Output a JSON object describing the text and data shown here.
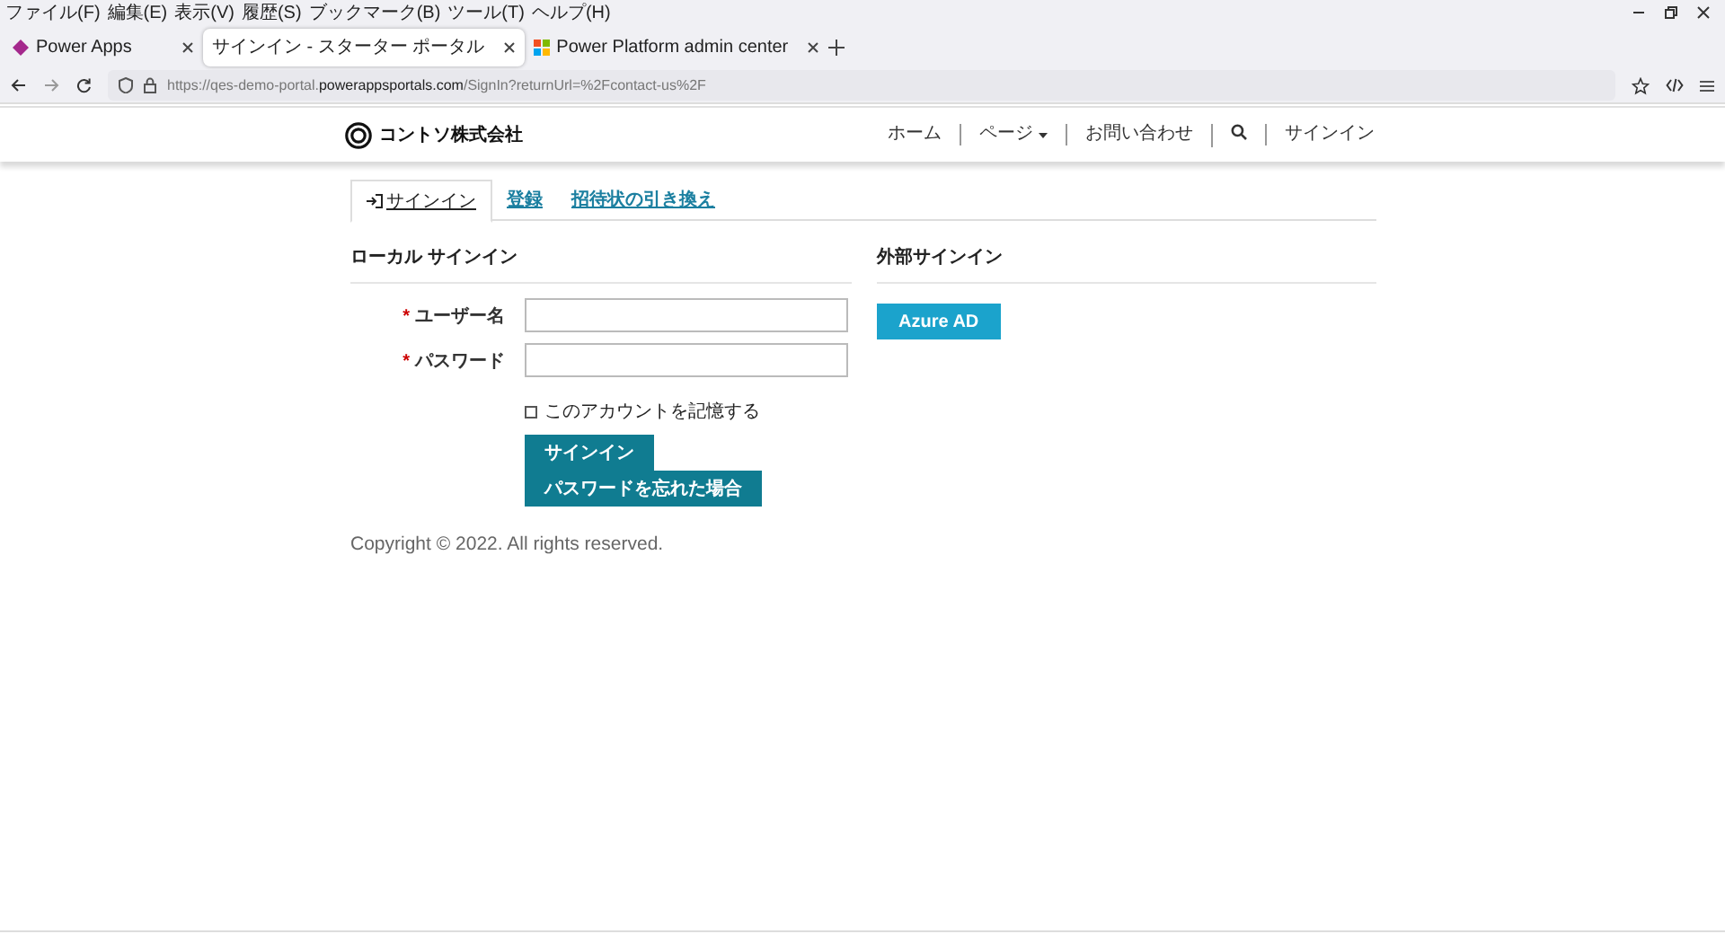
{
  "menu_bar": [
    "ファイル(F)",
    "編集(E)",
    "表示(V)",
    "履歴(S)",
    "ブックマーク(B)",
    "ツール(T)",
    "ヘルプ(H)"
  ],
  "tabs": [
    {
      "title": "Power Apps",
      "kind": "powerapps",
      "selected": false
    },
    {
      "title": "サインイン - スターター ポータル",
      "kind": "blank",
      "selected": true
    },
    {
      "title": "Power Platform admin center",
      "kind": "windows",
      "selected": false
    }
  ],
  "address_bar": {
    "prefix": "https://qes-demo-portal.",
    "domain": "powerappsportals.com",
    "path": "/SignIn?returnUrl=%2Fcontact-us%2F"
  },
  "site_header": {
    "brand": "コントソ株式会社",
    "nav": [
      {
        "label": "ホーム",
        "kind": "link"
      },
      {
        "label": "ページ",
        "kind": "dropdown"
      },
      {
        "label": "お問い合わせ",
        "kind": "link"
      },
      {
        "kind": "search"
      },
      {
        "label": "サインイン",
        "kind": "link"
      }
    ]
  },
  "signin_tabs": [
    {
      "label": "サインイン",
      "selected": true
    },
    {
      "label": "登録",
      "selected": false
    },
    {
      "label": "招待状の引き換え",
      "selected": false
    }
  ],
  "local_signin": {
    "title": "ローカル サインイン",
    "fields": [
      {
        "label": "ユーザー名",
        "required_mark": "*"
      },
      {
        "label": "パスワード",
        "required_mark": "*"
      }
    ],
    "remember": {
      "label": "このアカウントを記憶する",
      "checked": false
    },
    "buttons": [
      "サインイン",
      "パスワードを忘れた場合"
    ]
  },
  "external_signin": {
    "title": "外部サインイン",
    "buttons": [
      "Azure AD"
    ]
  },
  "footer": "Copyright © 2022. All rights reserved."
}
